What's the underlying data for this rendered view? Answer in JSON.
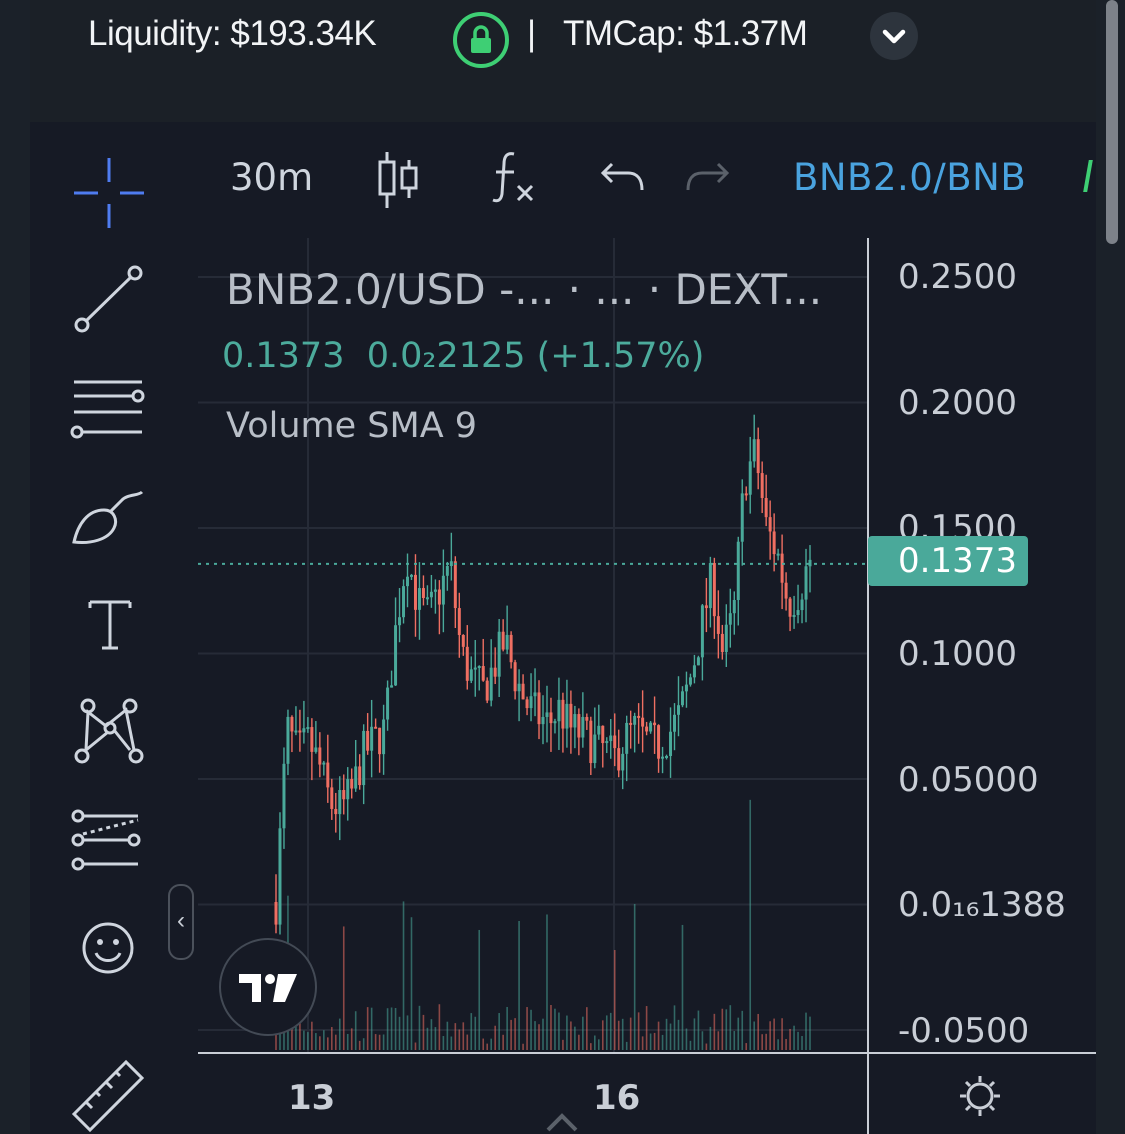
{
  "header": {
    "liquidity": "Liquidity: $193.34K",
    "separator": "|",
    "tmcap": "TMCap: $1.37M"
  },
  "toolbar": {
    "interval": "30m",
    "pair": "BNB2.0/BNB"
  },
  "legend": {
    "title": "BNB2.0/USD -...  · ...  · DEXT...",
    "price": "0.1373",
    "change": "0.0₂2125",
    "change_pct": "(+1.57%)",
    "indicator": "Volume SMA 9"
  },
  "price_axis": {
    "labels": [
      "0.2500",
      "0.2000",
      "0.1500",
      "0.1000",
      "0.05000",
      "0.0₁₆1388",
      "-0.0500"
    ],
    "current_price": "0.1373"
  },
  "time_axis": {
    "labels": [
      "13",
      "16"
    ]
  },
  "colors": {
    "up": "#4aa99a",
    "down": "#ef6f62",
    "accent": "#4aa3df",
    "lock": "#3ecf74",
    "background": "#161a25"
  },
  "left_tools": [
    "crosshair-icon",
    "trend-line-icon",
    "fib-retracement-icon",
    "brush-icon",
    "text-icon",
    "pattern-icon",
    "forecast-icon",
    "emoji-icon",
    "ruler-icon"
  ],
  "chart_data": {
    "type": "candlestick",
    "title": "BNB2.0/USD",
    "ylim": [
      -0.05,
      0.25
    ],
    "x_ticks": [
      "13",
      "16"
    ],
    "current_price": 0.1373,
    "series": [
      {
        "name": "BNB2.0/USD",
        "values": [
          0.001,
          0.07,
          0.06,
          0.065,
          0.055,
          0.04,
          0.038,
          0.045,
          0.06,
          0.065,
          0.07,
          0.11,
          0.14,
          0.12,
          0.115,
          0.125,
          0.135,
          0.1,
          0.09,
          0.085,
          0.095,
          0.105,
          0.09,
          0.08,
          0.075,
          0.072,
          0.078,
          0.07,
          0.068,
          0.065,
          0.062,
          0.058,
          0.066,
          0.07,
          0.065,
          0.063,
          0.068,
          0.075,
          0.09,
          0.11,
          0.13,
          0.1,
          0.115,
          0.17,
          0.18,
          0.15,
          0.14,
          0.12,
          0.125,
          0.1373
        ]
      }
    ],
    "volume_indicator": "Volume SMA 9"
  }
}
